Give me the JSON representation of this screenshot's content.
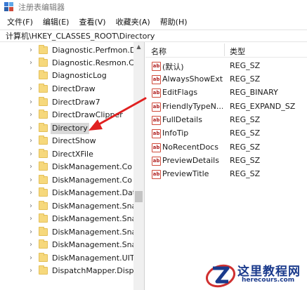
{
  "window": {
    "title": "注册表编辑器"
  },
  "menu": [
    "文件(F)",
    "编辑(E)",
    "查看(V)",
    "收藏夹(A)",
    "帮助(H)"
  ],
  "address": "计算机\\HKEY_CLASSES_ROOT\\Directory",
  "tree": {
    "items": [
      {
        "label": "Diagnostic.Perfmon.D",
        "has_children": true
      },
      {
        "label": "Diagnostic.Resmon.C",
        "has_children": true
      },
      {
        "label": "DiagnosticLog",
        "has_children": false
      },
      {
        "label": "DirectDraw",
        "has_children": true
      },
      {
        "label": "DirectDraw7",
        "has_children": true
      },
      {
        "label": "DirectDrawClipper",
        "has_children": true
      },
      {
        "label": "Directory",
        "has_children": true,
        "selected": true
      },
      {
        "label": "DirectShow",
        "has_children": true
      },
      {
        "label": "DirectXFile",
        "has_children": true
      },
      {
        "label": "DiskManagement.Co",
        "has_children": true
      },
      {
        "label": "DiskManagement.Co",
        "has_children": true
      },
      {
        "label": "DiskManagement.Dat",
        "has_children": true
      },
      {
        "label": "DiskManagement.Sna",
        "has_children": true
      },
      {
        "label": "DiskManagement.Sna",
        "has_children": true
      },
      {
        "label": "DiskManagement.Sna",
        "has_children": true
      },
      {
        "label": "DiskManagement.Sna",
        "has_children": true
      },
      {
        "label": "DiskManagement.UIT",
        "has_children": true
      },
      {
        "label": "DispatchMapper.Disp",
        "has_children": true
      }
    ]
  },
  "list": {
    "headers": {
      "name": "名称",
      "type": "类型"
    },
    "rows": [
      {
        "name": "(默认)",
        "type": "REG_SZ"
      },
      {
        "name": "AlwaysShowExt",
        "type": "REG_SZ"
      },
      {
        "name": "EditFlags",
        "type": "REG_BINARY"
      },
      {
        "name": "FriendlyTypeN...",
        "type": "REG_EXPAND_SZ"
      },
      {
        "name": "FullDetails",
        "type": "REG_SZ"
      },
      {
        "name": "InfoTip",
        "type": "REG_SZ"
      },
      {
        "name": "NoRecentDocs",
        "type": "REG_SZ"
      },
      {
        "name": "PreviewDetails",
        "type": "REG_SZ"
      },
      {
        "name": "PreviewTitle",
        "type": "REG_SZ"
      }
    ]
  },
  "watermark": {
    "title": "这里教程网",
    "url": "herecours.com"
  },
  "colors": {
    "selection": "#d9d9d9",
    "arrow": "#e02020",
    "watermark": "#1a3a8c"
  }
}
